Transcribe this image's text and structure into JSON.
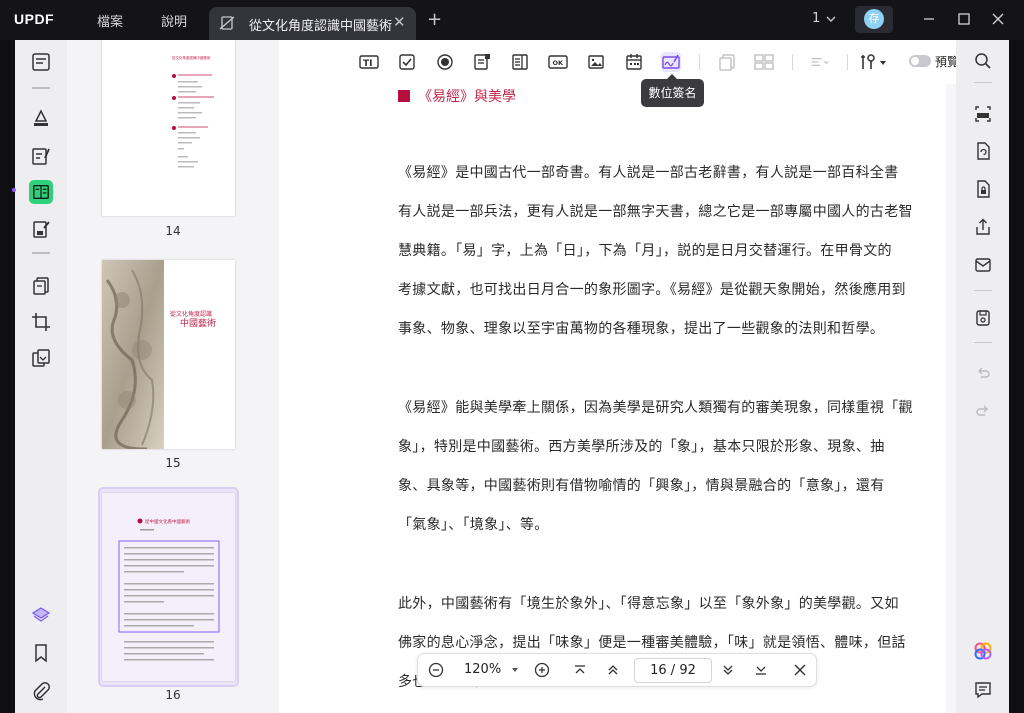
{
  "app": {
    "logo": "UPDF",
    "menu": [
      "檔案",
      "說明"
    ],
    "tab_title": "從文化角度認識中國藝術",
    "window_count": "1",
    "avatar_letter": "存"
  },
  "toolbar": {
    "tooltip": "數位簽名",
    "preview_label": "預覽"
  },
  "thumbnails": [
    {
      "page": "14",
      "lines_title": "從文化角度認識中國藝術",
      "banner_l1": "",
      "banner_l2": ""
    },
    {
      "page": "15",
      "lines_title": "",
      "banner_l1": "從文化角度認識",
      "banner_l2": "中國藝術"
    },
    {
      "page": "16",
      "lines_title": "從中國文化看中國藝術",
      "banner_l1": "",
      "banner_l2": ""
    }
  ],
  "document": {
    "heading": "《易經》與美學",
    "lines": [
      "《易經》是中國古代一部奇書。有人説是一部古老辭書，有人説是一部百科全書",
      "有人説是一部兵法，更有人説是一部無字天書，總之它是一部專屬中國人的古老智",
      "慧典籍。「易」字，上為「日」，下為「月」，説的是日月交替運行。在甲骨文的",
      "考據文獻，也可找出日月合一的象形圖字。《易經》是從觀天象開始，然後應用到",
      "事象、物象、理象以至宇宙萬物的各種現象，提出了一些觀象的法則和哲學。",
      "",
      "《易經》能與美學牽上關係，因為美學是研究人類獨有的審美現象，同樣重視「觀",
      "象」，特別是中國藝術。西方美學所涉及的「象」，基本只限於形象、現象、抽",
      "象、具象等，中國藝術則有借物喻情的「興象」，情與景融合的「意象」，還有",
      "「氣象」、「境象」、等。",
      "",
      "此外，中國藝術有「境生於象外」、「得意忘象」以至「象外象」的美學觀。又如",
      "佛家的息心淨念，提出「味象」便是一種審美體驗，「味」就是領悟、體味，但話",
      "多也有大有幫助。"
    ]
  },
  "zoom": {
    "value": "120%",
    "current_page": "16",
    "separator": "/",
    "total_pages": "92"
  },
  "colors": {
    "accent_purple": "#8a5cff",
    "active_green": "#2fd07a",
    "heading_red": "#c2254b"
  }
}
